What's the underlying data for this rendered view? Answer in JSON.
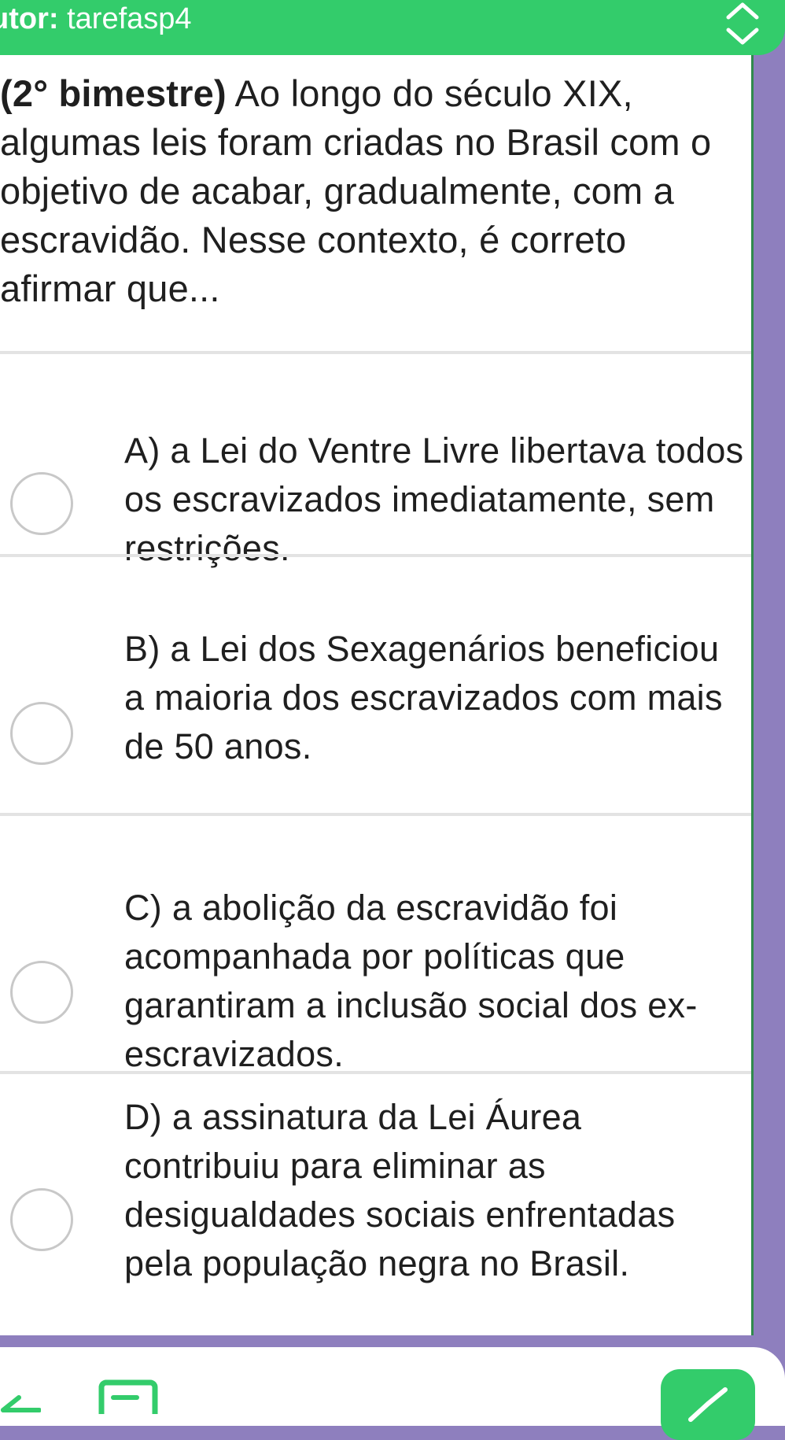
{
  "header": {
    "author_label": "utor:",
    "author_value": "tarefasp4",
    "toggle_icon": "chevron-up-down-icon"
  },
  "question": {
    "label": "(2° bimestre)",
    "text": "Ao longo do século XIX, algumas leis foram criadas no Brasil com o objetivo de acabar, gradualmente, com a escravidão. Nesse contexto, é correto afirmar que..."
  },
  "options": [
    {
      "text": "A) a Lei do Ventre Livre libertava todos os escravizados imediatamente, sem restrições."
    },
    {
      "text": "B) a Lei dos Sexagenários beneficiou a maioria dos escravizados com mais de 50 anos."
    },
    {
      "text": "C) a abolição da escravidão foi acompanhada por políticas que garantiram a inclusão social dos ex-escravizados."
    },
    {
      "text": "D) a assinatura da Lei Áurea contribuiu para eliminar as desigualdades sociais enfrentadas pela população negra no Brasil."
    }
  ],
  "toolbar": {
    "back_icon": "arrow-left-icon",
    "notes_icon": "edit-note-icon",
    "confirm_icon": "check-icon"
  },
  "colors": {
    "accent_green": "#33cc6b",
    "side_purple": "#8e7fbe",
    "panel_border": "#2f8a4c",
    "divider": "#e3e3e3",
    "text": "#1f1f1f"
  }
}
